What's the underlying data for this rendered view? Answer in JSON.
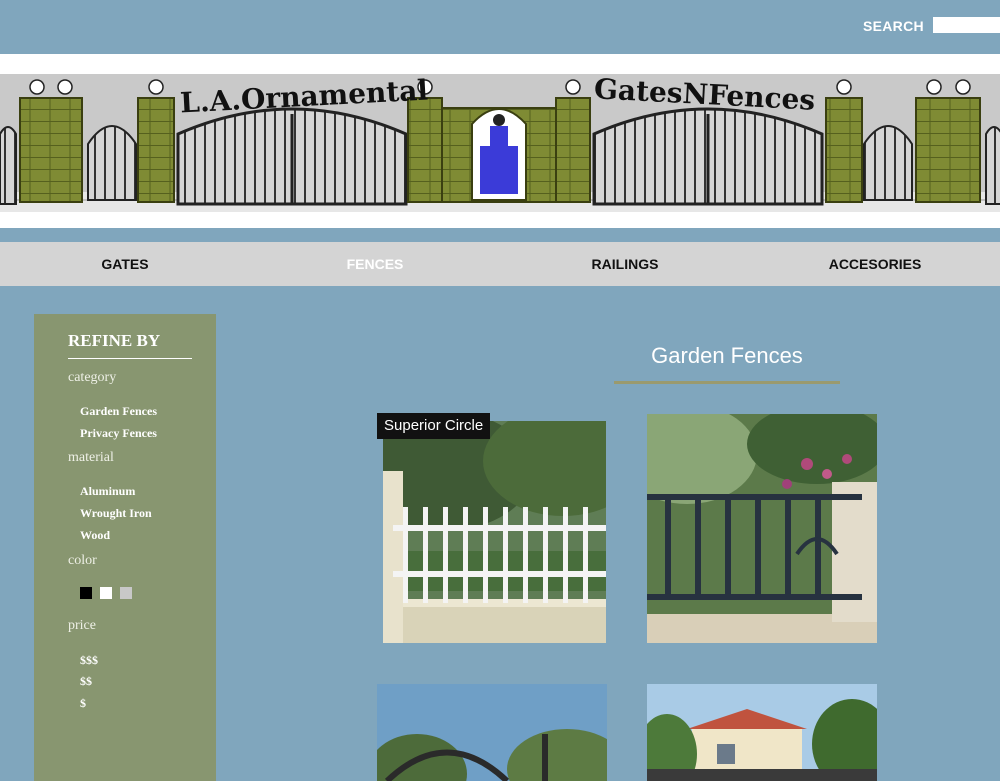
{
  "header": {
    "search_label": "SEARCH",
    "search_value": "",
    "banner_left": "L.A.Ornamental",
    "banner_right": "GatesNFences"
  },
  "nav": {
    "items": [
      {
        "label": "GATES"
      },
      {
        "label": "FENCES",
        "active": true
      },
      {
        "label": "RAILINGS"
      },
      {
        "label": "ACCESORIES"
      }
    ]
  },
  "sidebar": {
    "title": "REFINE BY",
    "category_label": "category",
    "categories": [
      "Garden Fences",
      "Privacy Fences"
    ],
    "material_label": "material",
    "materials": [
      "Aluminum",
      "Wrought Iron",
      "Wood"
    ],
    "color_label": "color",
    "colors": [
      "#000000",
      "#ffffff",
      "#c8c8c8"
    ],
    "price_label": "price",
    "prices": [
      "$$$",
      "$$",
      "$"
    ]
  },
  "main": {
    "title": "Garden Fences",
    "hover_caption": "Superior Circle"
  },
  "colors": {
    "page_bg": "#80a6bd",
    "sidebar_bg": "#889670",
    "nav_bg": "#d4d4d4",
    "accent_olive": "#7f8b34"
  }
}
